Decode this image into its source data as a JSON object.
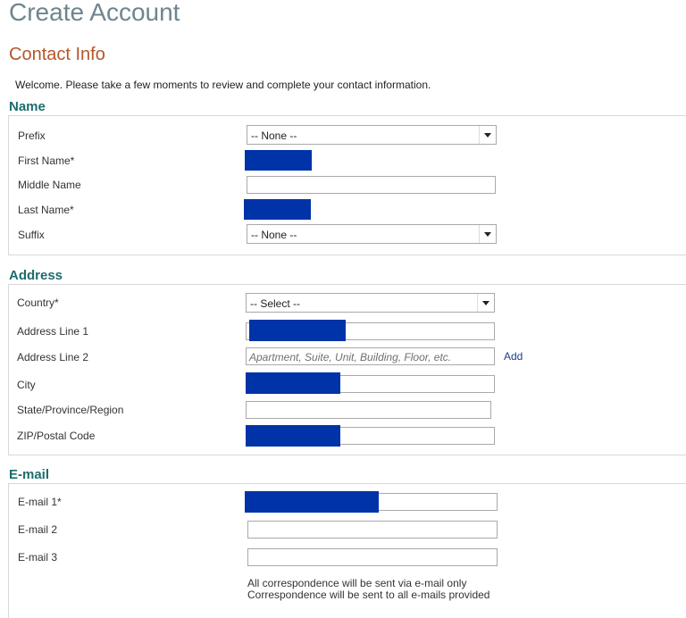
{
  "header": {
    "title": "Create Account",
    "subtitle": "Contact Info",
    "intro": "Welcome. Please take a few moments to review and complete your contact information."
  },
  "name_section": {
    "heading": "Name",
    "prefix_label": "Prefix",
    "prefix_value": "-- None --",
    "first_name_label": "First Name*",
    "middle_name_label": "Middle Name",
    "last_name_label": "Last Name*",
    "suffix_label": "Suffix",
    "suffix_value": "-- None --"
  },
  "address_section": {
    "heading": "Address",
    "country_label": "Country*",
    "country_value": "-- Select --",
    "line1_label": "Address Line 1",
    "line2_label": "Address Line 2",
    "line2_placeholder": "Apartment, Suite, Unit, Building, Floor, etc.",
    "add_link": "Add",
    "city_label": "City",
    "state_label": "State/Province/Region",
    "zip_label": "ZIP/Postal Code"
  },
  "email_section": {
    "heading": "E-mail",
    "email1_label": "E-mail 1*",
    "email2_label": "E-mail 2",
    "email3_label": "E-mail 3",
    "note_line1": "All correspondence will be sent via e-mail only",
    "note_line2": "Correspondence will be sent to all e-mails provided"
  },
  "colors": {
    "redaction": "#0033a8",
    "section_heading": "#1d6c6e",
    "subtitle": "#b5562a",
    "title": "#6d8590",
    "link": "#1a3f8f"
  }
}
